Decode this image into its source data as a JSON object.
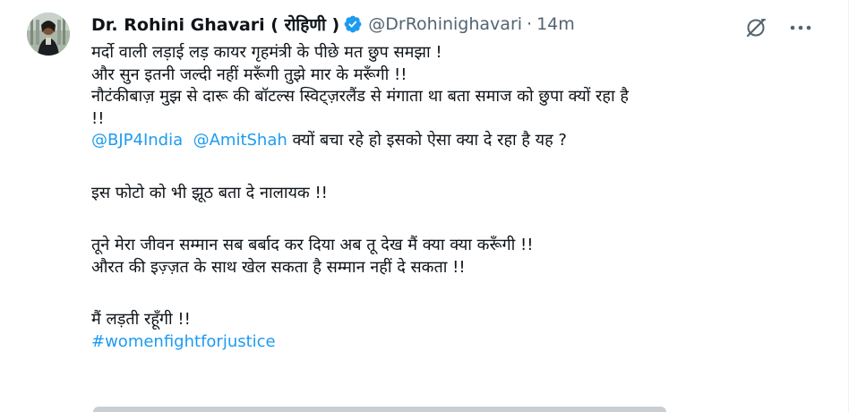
{
  "tweet": {
    "author": {
      "display_name": "Dr. Rohini Ghavari ( रोहिणी )",
      "handle": "@DrRohinighavari",
      "separator": "·",
      "timestamp": "14m",
      "verified_color": "#1d9bf0"
    },
    "icons": {
      "grok": "grok-icon",
      "more": "more-options-icon",
      "verified": "verified-badge-icon"
    },
    "body": {
      "line1": "मर्दो वाली लड़ाई लड़ कायर गृहमंत्री के पीछे मत छुप समझा !",
      "line2": "और सुन इतनी जल्दी नहीं मरूँगी तुझे मार के मरूँगी !!",
      "line3": "नौटंकीबाज़ मुझ से दारू की बॉटल्स स्विट्ज़रलैंड से मंगाता था बता समाज को छुपा क्यों रहा है",
      "line4": "!!",
      "mention1": "@BJP4India",
      "mention2": "@AmitShah",
      "line5_rest": " क्यों बचा रहे हो इसको ऐसा क्या दे रहा है यह ?",
      "line6": "इस फोटो को भी झूठ बता दे नालायक !!",
      "line7": "तूने मेरा जीवन सम्मान सब बर्बाद कर दिया अब तू देख मैं क्या क्या करूँगी !!",
      "line8": "औरत की इज़्ज़त के साथ खेल सकता है सम्मान नहीं दे सकता !!",
      "line9": "मैं लड़ती रहूँगी !!",
      "hashtag": "#womenfightforjustice"
    },
    "colors": {
      "text": "#0f1419",
      "secondary": "#536471",
      "link": "#1d9bf0"
    }
  }
}
